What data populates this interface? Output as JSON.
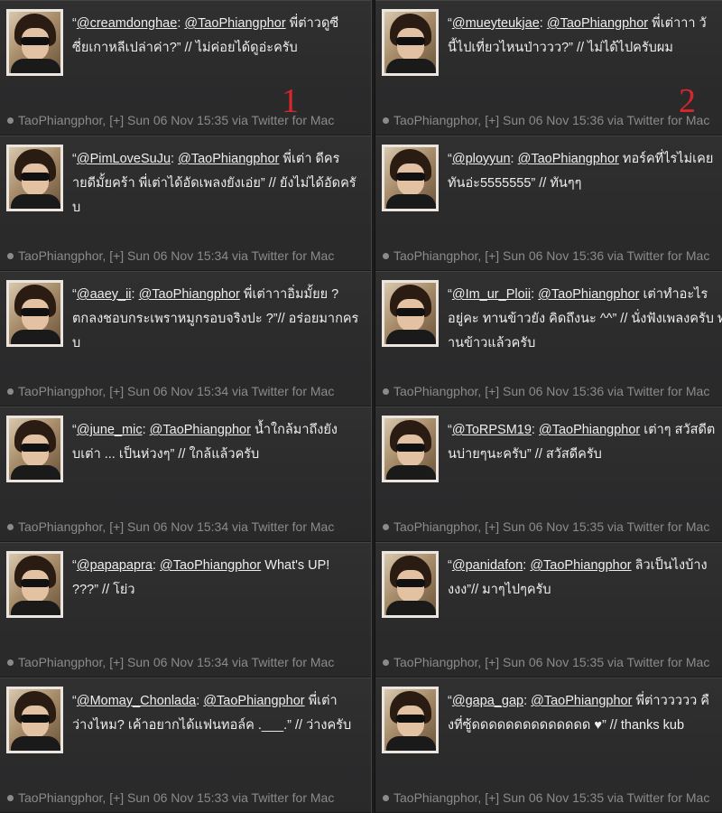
{
  "columns": [
    {
      "number": "1",
      "tweets": [
        {
          "lines": [
            [
              "“",
              "@creamdonghae",
              ": ",
              "@TaoPhiangphor",
              " พี่ต่าวดูซี"
            ],
            [
              "ซี่ยเกาหลีเปล่าค่า?” // ไม่ค่อยได้ดูอ่ะครับ"
            ]
          ],
          "meta": "TaoPhiangphor, [+] Sun 06 Nov 15:35 via Twitter for Mac"
        },
        {
          "lines": [
            [
              "“",
              "@PimLoveSuJu",
              ": ",
              "@TaoPhiangphor",
              " พี่เต่า ดีคร"
            ],
            [
              "ายดีมั้ยคร้า พี่เต่าได้อัดเพลงยังเอ่ย” // ยังไม่ได้อัดครั"
            ],
            [
              "บ"
            ]
          ],
          "meta": "TaoPhiangphor, [+] Sun 06 Nov 15:34 via Twitter for Mac"
        },
        {
          "lines": [
            [
              "“",
              "@aaey_ii",
              ": ",
              "@TaoPhiangphor",
              " พี่เต่าาาอิ่มมั้ยย ?"
            ],
            [
              "ตกลงชอบกระเพราหมูกรอบจริงปะ ?”// อร่อยมากคร"
            ],
            [
              "ับ"
            ]
          ],
          "meta": "TaoPhiangphor, [+] Sun 06 Nov 15:34 via Twitter for Mac"
        },
        {
          "lines": [
            [
              "“",
              "@june_mic",
              ": ",
              "@TaoPhiangphor",
              " น้ำใกล้มาถึงยัง"
            ],
            [
              "บเต่า ... เป็นห่วงๆ” // ใกล้แล้วครับ"
            ]
          ],
          "meta": "TaoPhiangphor, [+] Sun 06 Nov 15:34 via Twitter for Mac"
        },
        {
          "lines": [
            [
              "“",
              "@papapapra",
              ": ",
              "@TaoPhiangphor",
              " What's UP!"
            ],
            [
              "???” // โย่ว"
            ]
          ],
          "meta": "TaoPhiangphor, [+] Sun 06 Nov 15:34 via Twitter for Mac"
        },
        {
          "lines": [
            [
              "“",
              "@Momay_Chonlada",
              ": ",
              "@TaoPhiangphor",
              " พี่เต่า"
            ],
            [
              "ว่างไหม? เค้าอยากได้แฟนทอล์ค .___.” // ว่างครับ"
            ]
          ],
          "meta": "TaoPhiangphor, [+] Sun 06 Nov 15:33 via Twitter for Mac"
        }
      ]
    },
    {
      "number": "2",
      "tweets": [
        {
          "lines": [
            [
              "“",
              "@mueyteukjae",
              ": ",
              "@TaoPhiangphor",
              " พี่เต่าาา วั"
            ],
            [
              "นี้ไปเที่ยวไหนป่าววว?” // ไม่ได้ไปครับผม"
            ]
          ],
          "meta": "TaoPhiangphor, [+] Sun 06 Nov 15:36 via Twitter for Mac"
        },
        {
          "lines": [
            [
              "“",
              "@ployyun",
              ": ",
              "@TaoPhiangphor",
              " ทอร์คที่ไรไม่เคย"
            ],
            [
              "ทันอ่ะ5555555” // ทันๆๆ"
            ]
          ],
          "meta": "TaoPhiangphor, [+] Sun 06 Nov 15:36 via Twitter for Mac"
        },
        {
          "lines": [
            [
              "“",
              "@Im_ur_Ploii",
              ": ",
              "@TaoPhiangphor",
              " เต่าทำอะไร"
            ],
            [
              "อยู่คะ ทานข้าวยัง คิดถึงนะ ^^” // นั่งฟังเพลงครับ ท"
            ],
            [
              "านข้าวแล้วครับ"
            ]
          ],
          "meta": "TaoPhiangphor, [+] Sun 06 Nov 15:36 via Twitter for Mac"
        },
        {
          "lines": [
            [
              "“",
              "@ToRPSM19",
              ": ",
              "@TaoPhiangphor",
              " เต่าๆ สวัสดีต"
            ],
            [
              "นบ่ายๆนะครับ” // สวัสดีครับ"
            ]
          ],
          "meta": "TaoPhiangphor, [+] Sun 06 Nov 15:35 via Twitter for Mac"
        },
        {
          "lines": [
            [
              "“",
              "@panidafon",
              ": ",
              "@TaoPhiangphor",
              " ลิวเป็นไงบ้าง"
            ],
            [
              "งงง”// มาๆไปๆครับ"
            ]
          ],
          "meta": "TaoPhiangphor, [+] Sun 06 Nov 15:35 via Twitter for Mac"
        },
        {
          "lines": [
            [
              "“",
              "@gapa_gap",
              ": ",
              "@TaoPhiangphor",
              " พี่ต่าววววว คื"
            ],
            [
              "งที่ซู้ดดดดดดดดดดดดดด ♥” // thanks kub"
            ]
          ],
          "meta": "TaoPhiangphor, [+] Sun 06 Nov 15:35 via Twitter for Mac"
        }
      ]
    }
  ]
}
